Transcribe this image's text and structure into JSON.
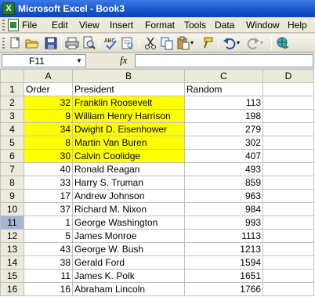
{
  "title_bar": {
    "app_icon_letter": "X",
    "title": "Microsoft Excel - Book3"
  },
  "menu": [
    "File",
    "Edit",
    "View",
    "Insert",
    "Format",
    "Tools",
    "Data",
    "Window",
    "Help"
  ],
  "toolbar": {
    "buttons": [
      "new-icon",
      "open-icon",
      "save-icon",
      "print-icon",
      "print-preview-icon",
      "spelling-icon",
      "cut-icon",
      "copy-icon",
      "paste-icon",
      "format-painter-icon",
      "undo-icon",
      "redo-icon",
      "hyperlink-icon"
    ]
  },
  "formula_bar": {
    "name_box": "F11",
    "fx": "fx",
    "formula": ""
  },
  "columns": [
    "A",
    "B",
    "C",
    "D"
  ],
  "rows": [
    {
      "n": "1",
      "a": "Order",
      "b": "President",
      "c": "Random",
      "hl": false,
      "header": true
    },
    {
      "n": "2",
      "a": "32",
      "b": "Franklin Roosevelt",
      "c": "113",
      "hl": true
    },
    {
      "n": "3",
      "a": "9",
      "b": "William Henry Harrison",
      "c": "198",
      "hl": true
    },
    {
      "n": "4",
      "a": "34",
      "b": "Dwight D. Eisenhower",
      "c": "279",
      "hl": true
    },
    {
      "n": "5",
      "a": "8",
      "b": "Martin Van Buren",
      "c": "302",
      "hl": true
    },
    {
      "n": "6",
      "a": "30",
      "b": "Calvin Coolidge",
      "c": "407",
      "hl": true
    },
    {
      "n": "7",
      "a": "40",
      "b": "Ronald Reagan",
      "c": "493",
      "hl": false
    },
    {
      "n": "8",
      "a": "33",
      "b": "Harry S. Truman",
      "c": "859",
      "hl": false
    },
    {
      "n": "9",
      "a": "17",
      "b": "Andrew Johnson",
      "c": "963",
      "hl": false
    },
    {
      "n": "10",
      "a": "37",
      "b": "Richard M. Nixon",
      "c": "984",
      "hl": false
    },
    {
      "n": "11",
      "a": "1",
      "b": "George Washington",
      "c": "993",
      "hl": false,
      "active": true
    },
    {
      "n": "12",
      "a": "5",
      "b": "James Monroe",
      "c": "1113",
      "hl": false
    },
    {
      "n": "13",
      "a": "43",
      "b": "George W. Bush",
      "c": "1213",
      "hl": false
    },
    {
      "n": "14",
      "a": "38",
      "b": "Gerald Ford",
      "c": "1594",
      "hl": false
    },
    {
      "n": "15",
      "a": "11",
      "b": "James K. Polk",
      "c": "1651",
      "hl": false
    },
    {
      "n": "16",
      "a": "16",
      "b": "Abraham Lincoln",
      "c": "1766",
      "hl": false
    }
  ],
  "colors": {
    "highlight": "#ffff00",
    "active_row_header": "#a6b3d1",
    "title_bar": "#0a44b8"
  }
}
